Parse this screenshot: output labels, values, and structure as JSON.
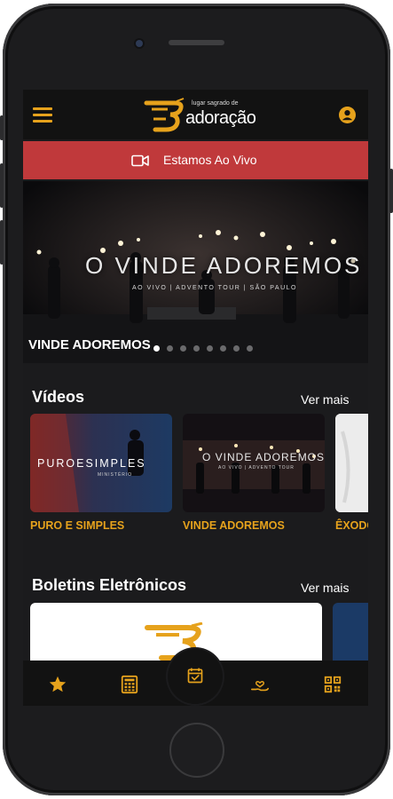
{
  "header": {
    "logo_tagline": "lugar sagrado de",
    "logo_name": "adoração",
    "icons": {
      "menu": "menu-icon",
      "user": "user-icon"
    }
  },
  "live": {
    "label": "Estamos Ao Vivo",
    "icon": "video-camera-icon"
  },
  "hero": {
    "title": "O VINDE ADOREMOS",
    "subtitle": "AO VIVO | ADVENTO TOUR | SÃO PAULO",
    "caption": "VINDE ADOREMOS",
    "slides_count": 8,
    "active_slide": 0
  },
  "videos": {
    "title": "Vídeos",
    "see_more": "Ver mais",
    "items": [
      {
        "label": "PURO E SIMPLES",
        "thumb_text": "PUROESIMPLES",
        "thumb_sub": "MINISTÉRIO"
      },
      {
        "label": "VINDE ADOREMOS",
        "thumb_text": "O VINDE ADOREMOS",
        "thumb_sub": "AO VIVO | ADVENTO TOUR"
      },
      {
        "label": "ÊXODO"
      }
    ]
  },
  "bulletins": {
    "title": "Boletins Eletrônicos",
    "see_more": "Ver mais"
  },
  "bottom_nav": {
    "items": [
      {
        "icon": "star-icon"
      },
      {
        "icon": "calculator-icon"
      },
      {
        "icon": "calendar-check-icon"
      },
      {
        "icon": "hand-heart-icon"
      },
      {
        "icon": "qr-code-icon"
      }
    ]
  },
  "colors": {
    "accent": "#e6a21c",
    "live": "#c0393b",
    "background": "#1b1b1d",
    "bar": "#121212"
  }
}
